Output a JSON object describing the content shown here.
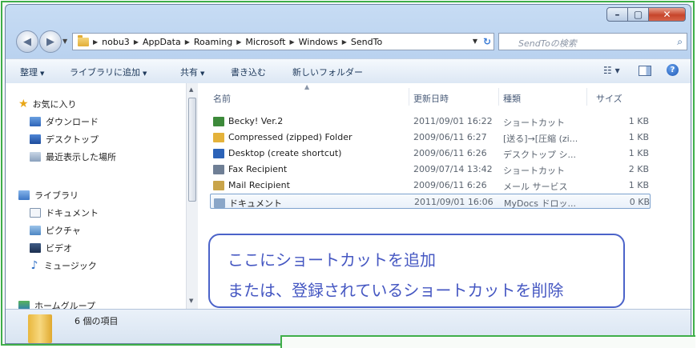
{
  "window": {
    "caption_buttons": [
      "minimize",
      "maximize",
      "close"
    ]
  },
  "address_bar": {
    "breadcrumbs": [
      "nobu3",
      "AppData",
      "Roaming",
      "Microsoft",
      "Windows",
      "SendTo"
    ]
  },
  "search": {
    "placeholder": "SendToの検索"
  },
  "toolbar": {
    "organize": "整理",
    "add_to_library": "ライブラリに追加",
    "share": "共有",
    "burn": "書き込む",
    "new_folder": "新しいフォルダー"
  },
  "nav_pane": {
    "favorites": {
      "label": "お気に入り",
      "items": [
        {
          "label": "ダウンロード",
          "icon": "downloads-icon"
        },
        {
          "label": "デスクトップ",
          "icon": "desktop-icon"
        },
        {
          "label": "最近表示した場所",
          "icon": "recent-places-icon"
        }
      ]
    },
    "libraries": {
      "label": "ライブラリ",
      "items": [
        {
          "label": "ドキュメント",
          "icon": "documents-icon"
        },
        {
          "label": "ピクチャ",
          "icon": "pictures-icon"
        },
        {
          "label": "ビデオ",
          "icon": "videos-icon"
        },
        {
          "label": "ミュージック",
          "icon": "music-icon"
        }
      ]
    },
    "homegroup": {
      "label": "ホームグループ"
    }
  },
  "file_list": {
    "columns": {
      "name": "名前",
      "date": "更新日時",
      "type": "種類",
      "size": "サイズ"
    },
    "rows": [
      {
        "name": "Becky! Ver.2",
        "date": "2011/09/01 16:22",
        "type": "ショートカット",
        "size": "1 KB",
        "icon": "becky-shortcut-icon",
        "color": "#3d8a3a"
      },
      {
        "name": "Compressed (zipped) Folder",
        "date": "2009/06/11 6:27",
        "type": "[送る]→[圧縮 (zi...",
        "size": "1 KB",
        "icon": "zip-folder-icon",
        "color": "#e4b23a"
      },
      {
        "name": "Desktop (create shortcut)",
        "date": "2009/06/11 6:26",
        "type": "デスクトップ シ...",
        "size": "1 KB",
        "icon": "desktop-shortcut-icon",
        "color": "#2c63b8"
      },
      {
        "name": "Fax Recipient",
        "date": "2009/07/14 13:42",
        "type": "ショートカット",
        "size": "2 KB",
        "icon": "fax-icon",
        "color": "#6f7f95"
      },
      {
        "name": "Mail Recipient",
        "date": "2009/06/11 6:26",
        "type": "メール サービス",
        "size": "1 KB",
        "icon": "mail-icon",
        "color": "#c9a44a"
      },
      {
        "name": "ドキュメント",
        "date": "2011/09/01 16:06",
        "type": "MyDocs ドロッ...",
        "size": "0 KB",
        "icon": "document-icon",
        "color": "#8aa6c8"
      }
    ]
  },
  "callout": {
    "line1": "ここにショートカットを追加",
    "line2": "または、登録されているショートカットを削除"
  },
  "details_pane": {
    "item_count": "6 個の項目"
  },
  "colors": {
    "accent_frame": "#3fae49",
    "callout": "#4b63c9",
    "selection": "#7da2ce"
  }
}
